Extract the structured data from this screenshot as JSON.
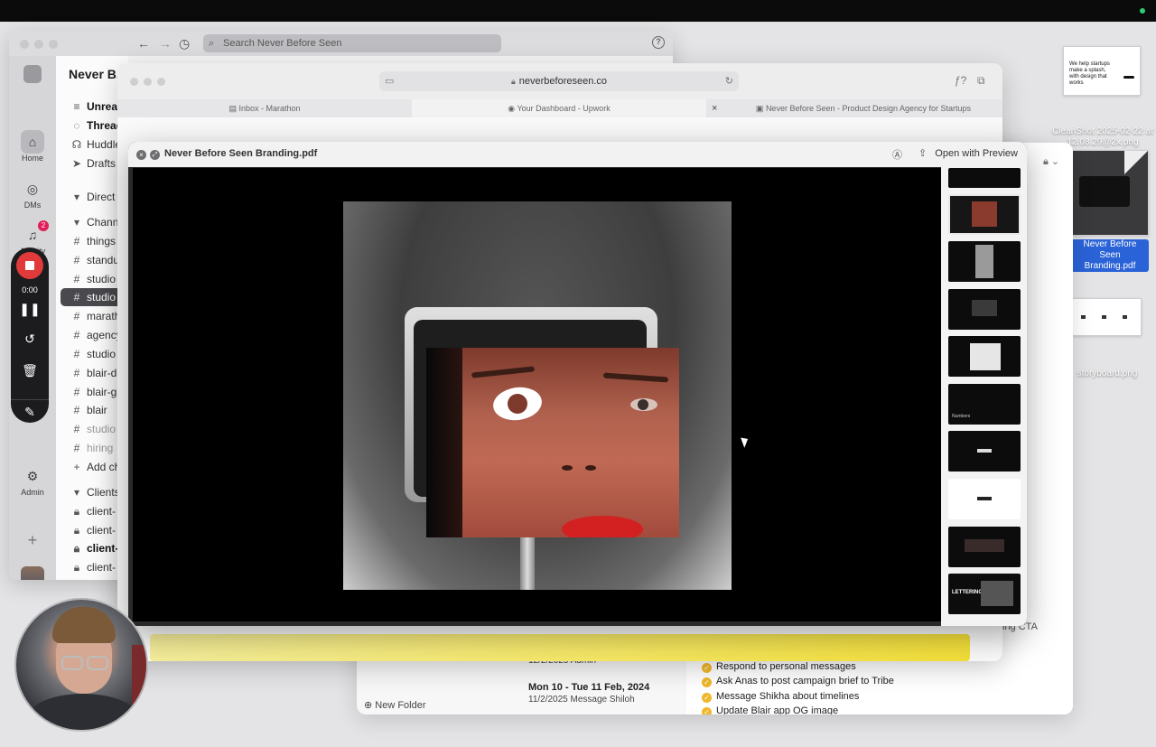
{
  "desktop": {
    "files": [
      {
        "label": "",
        "thumb_text": "We help startups make a splash, with design that works"
      },
      {
        "label": "CleanShot 2025-02-22 at 12.08.29@2x.png"
      },
      {
        "label": "Never Before Seen Branding.pdf"
      },
      {
        "label": "storyboard.png"
      }
    ]
  },
  "slack": {
    "search_placeholder": "Search Never Before Seen",
    "workspace": "Never B...",
    "rail": [
      {
        "label": "Home",
        "icon": "home-icon"
      },
      {
        "label": "DMs",
        "icon": "dm-icon"
      },
      {
        "label": "Activity",
        "icon": "bell-icon",
        "badge": "2"
      },
      {
        "label": "Admin",
        "icon": "gear-icon"
      }
    ],
    "sidebar": {
      "top": [
        {
          "label": "Unreads",
          "icon": "≡"
        },
        {
          "label": "Threads",
          "icon": "◌"
        },
        {
          "label": "Huddles",
          "icon": "☊"
        },
        {
          "label": "Drafts",
          "icon": "➤"
        }
      ],
      "sections": [
        {
          "label": "Direct messages"
        },
        {
          "label": "Channels"
        }
      ],
      "channels": [
        {
          "label": "things"
        },
        {
          "label": "standup"
        },
        {
          "label": "studio"
        },
        {
          "label": "studio"
        },
        {
          "label": "marathon"
        },
        {
          "label": "agency"
        },
        {
          "label": "studio"
        },
        {
          "label": "blair-d"
        },
        {
          "label": "blair-g"
        },
        {
          "label": "blair"
        },
        {
          "label": "studio"
        },
        {
          "label": "hiring"
        }
      ],
      "add_channel": "Add channels",
      "clients_header": "Clients",
      "clients": [
        {
          "label": "client-"
        },
        {
          "label": "client-"
        },
        {
          "label": "client-"
        },
        {
          "label": "client-"
        }
      ]
    }
  },
  "recorder": {
    "time": "0:00"
  },
  "browser": {
    "url": "neverbeforeseen.co",
    "tabs": [
      {
        "label": "Inbox - Marathon"
      },
      {
        "label": "Your Dashboard - Upwork"
      },
      {
        "label": "Never Before Seen - Product Design Agency for Startups"
      }
    ]
  },
  "finder": {
    "rows": [
      {
        "date": "",
        "sub": "12/2/2025   Admin"
      },
      {
        "date": "Mon 10 - Tue 11 Feb, 2024",
        "sub": "11/2/2025   Message Shiloh"
      }
    ],
    "tasks": [
      "Respond to personal messages",
      "Ask Anas to post campaign brief to Tribe",
      "Message Shikha about timelines",
      "Update Blair app OG image"
    ],
    "new_folder": "New Folder",
    "peek_text": "ing CTA"
  },
  "quicklook": {
    "title": "Never Before Seen Branding.pdf",
    "open_with": "Open with Preview",
    "thumbnails": [
      {
        "label": ""
      },
      {
        "label": ""
      },
      {
        "label": ""
      },
      {
        "label": ""
      },
      {
        "label": ""
      },
      {
        "label": "Numbers"
      },
      {
        "label": ""
      },
      {
        "label": ""
      },
      {
        "label": ""
      },
      {
        "label": "LETTERING"
      }
    ]
  }
}
